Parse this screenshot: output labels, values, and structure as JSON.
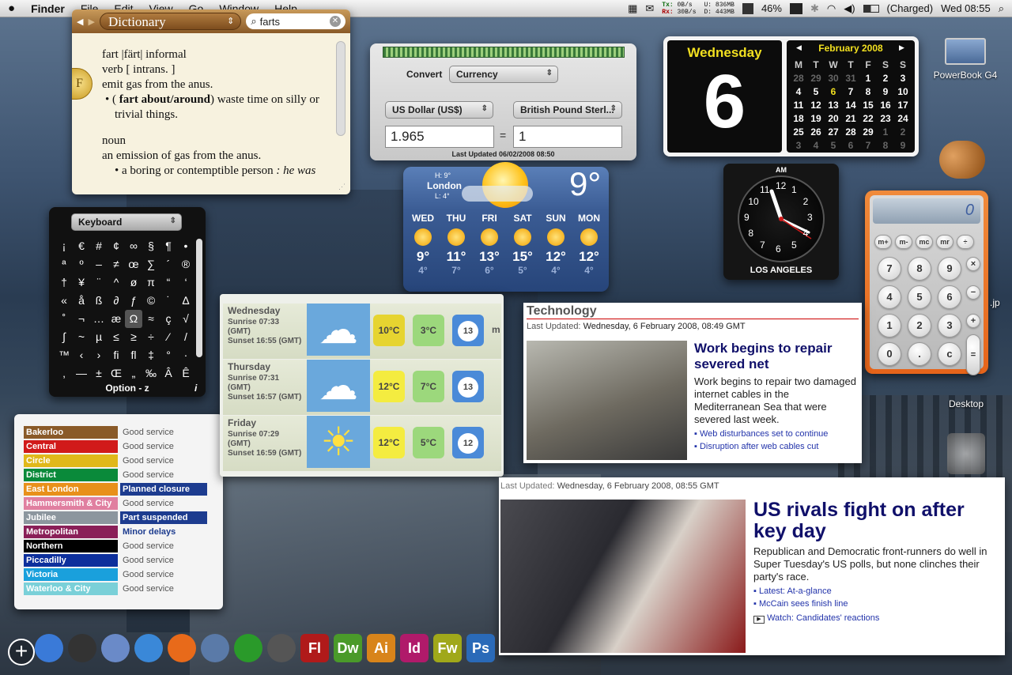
{
  "menubar": {
    "apple": "",
    "app": "Finder",
    "items": [
      "File",
      "Edit",
      "View",
      "Go",
      "Window",
      "Help"
    ],
    "net": {
      "tx_label": "Tx:",
      "rx_label": "Rx:",
      "tx_rate": "0B/s",
      "rx_rate": "30B/s",
      "u_label": "U:",
      "d_label": "D:",
      "u_val": "836MB",
      "d_val": "443MB"
    },
    "battery": "46%",
    "charge_status": "(Charged)",
    "clock": "Wed 08:55"
  },
  "dictionary": {
    "source": "Dictionary",
    "query": "farts",
    "headword": "fart |färt| informal",
    "pos1": "verb [ intrans. ]",
    "def1": "emit gas from the anus.",
    "sub1_bold": "fart about/around",
    "sub1_rest": " waste time on silly or trivial things.",
    "sub1_prefix": "( ",
    "sub1_close": ")",
    "pos2": "noun",
    "def2": "an emission of gas from the anus.",
    "def3": "a boring or contemptible person",
    "def3_example": " : he was",
    "badge": "F"
  },
  "currency": {
    "convert_label": "Convert",
    "mode": "Currency",
    "from": "US Dollar (US$)",
    "to": "British Pound Sterl...",
    "from_value": "1.965",
    "to_value": "1",
    "equals": "=",
    "updated": "Last Updated 06/02/2008 08:50"
  },
  "keyboard_viewer": {
    "mode": "Keyboard",
    "chars": [
      "¡",
      "€",
      "#",
      "¢",
      "∞",
      "§",
      "¶",
      "•",
      "ª",
      "º",
      "–",
      "≠",
      "œ",
      "∑",
      "´",
      "®",
      "†",
      "¥",
      "¨",
      "^",
      "ø",
      "π",
      "“",
      "‘",
      "«",
      "å",
      "ß",
      "∂",
      "ƒ",
      "©",
      "˙",
      "∆",
      "˚",
      "¬",
      "…",
      "æ",
      "Ω",
      "≈",
      "ç",
      "√",
      "∫",
      "~",
      "µ",
      "≤",
      "≥",
      "÷",
      "⁄",
      "/",
      "™",
      "‹",
      "›",
      "fi",
      "fl",
      "‡",
      "°",
      "·",
      "‚",
      "—",
      "±",
      "Œ",
      "„",
      "‰",
      "Â",
      "Ê"
    ],
    "footer": "Option - z",
    "info": "i"
  },
  "weather": {
    "city": "London",
    "high": "H: 9°",
    "low": "L: 4°",
    "current": "9°",
    "days": [
      {
        "d": "WED",
        "hi": "9°",
        "lo": "4°"
      },
      {
        "d": "THU",
        "hi": "11°",
        "lo": "7°"
      },
      {
        "d": "FRI",
        "hi": "13°",
        "lo": "6°"
      },
      {
        "d": "SAT",
        "hi": "15°",
        "lo": "5°"
      },
      {
        "d": "SUN",
        "hi": "12°",
        "lo": "4°"
      },
      {
        "d": "MON",
        "hi": "12°",
        "lo": "4°"
      }
    ]
  },
  "calendar": {
    "weekday": "Wednesday",
    "day": "6",
    "month": "February 2008",
    "headers": [
      "M",
      "T",
      "W",
      "T",
      "F",
      "S",
      "S"
    ],
    "weeks": [
      [
        "28",
        "29",
        "30",
        "31",
        "1",
        "2",
        "3"
      ],
      [
        "4",
        "5",
        "6",
        "7",
        "8",
        "9",
        "10"
      ],
      [
        "11",
        "12",
        "13",
        "14",
        "15",
        "16",
        "17"
      ],
      [
        "18",
        "19",
        "20",
        "21",
        "22",
        "23",
        "24"
      ],
      [
        "25",
        "26",
        "27",
        "28",
        "29",
        "1",
        "2"
      ],
      [
        "3",
        "4",
        "5",
        "6",
        "7",
        "8",
        "9"
      ]
    ]
  },
  "clock": {
    "ampm": "AM",
    "city": "LOS ANGELES",
    "numbers": [
      "12",
      "1",
      "2",
      "3",
      "4",
      "5",
      "6",
      "7",
      "8",
      "9",
      "10",
      "11"
    ]
  },
  "calculator": {
    "display": "0",
    "rows": [
      [
        "m+",
        "m-",
        "mc",
        "mr",
        "÷"
      ],
      [
        "7",
        "8",
        "9",
        "×"
      ],
      [
        "4",
        "5",
        "6",
        "−"
      ],
      [
        "1",
        "2",
        "3",
        "+"
      ],
      [
        "0",
        ".",
        "c",
        "="
      ]
    ]
  },
  "tube": {
    "lines": [
      {
        "name": "Bakerloo",
        "color": "#8a5a28",
        "status": "Good service",
        "kind": "good"
      },
      {
        "name": "Central",
        "color": "#d11a1a",
        "status": "Good service",
        "kind": "good"
      },
      {
        "name": "Circle",
        "color": "#e0b81a",
        "status": "Good service",
        "kind": "good"
      },
      {
        "name": "District",
        "color": "#0a8a3a",
        "status": "Good service",
        "kind": "good"
      },
      {
        "name": "East London",
        "color": "#e8901a",
        "status": "Planned closure",
        "kind": "alert"
      },
      {
        "name": "Hammersmith & City",
        "color": "#e07fa0",
        "status": "Good service",
        "kind": "good"
      },
      {
        "name": "Jubilee",
        "color": "#8c969e",
        "status": "Part suspended",
        "kind": "alert"
      },
      {
        "name": "Metropolitan",
        "color": "#8a1f58",
        "status": "Minor delays",
        "kind": "minor"
      },
      {
        "name": "Northern",
        "color": "#000000",
        "status": "Good service",
        "kind": "good"
      },
      {
        "name": "Piccadilly",
        "color": "#0d2f9c",
        "status": "Good service",
        "kind": "good"
      },
      {
        "name": "Victoria",
        "color": "#1aa0dc",
        "status": "Good service",
        "kind": "good"
      },
      {
        "name": "Waterloo & City",
        "color": "#7ad0d8",
        "status": "Good service",
        "kind": "good"
      }
    ]
  },
  "forecast3": {
    "overflow_unit": "m",
    "days": [
      {
        "day": "Wednesday",
        "sunrise": "Sunrise 07:33 (GMT)",
        "sunset": "Sunset 16:55 (GMT)",
        "max": "10°C",
        "min": "3°C",
        "wind": "13"
      },
      {
        "day": "Thursday",
        "sunrise": "Sunrise 07:31 (GMT)",
        "sunset": "Sunset 16:57 (GMT)",
        "max": "12°C",
        "min": "7°C",
        "wind": "13"
      },
      {
        "day": "Friday",
        "sunrise": "Sunrise 07:29 (GMT)",
        "sunset": "Sunset 16:59 (GMT)",
        "max": "12°C",
        "min": "5°C",
        "wind": "12"
      }
    ]
  },
  "tech_news": {
    "section": "Technology",
    "updated_label": "Last Updated:",
    "updated": "Wednesday, 6 February 2008, 08:49 GMT",
    "headline": "Work begins to repair severed net",
    "summary": "Work begins to repair two damaged internet cables in the Mediterranean Sea that were severed last week.",
    "links": [
      "Web disturbances set to continue",
      "Disruption after web cables cut"
    ]
  },
  "us_news": {
    "updated_label": "Last Updated:",
    "updated": "Wednesday, 6 February 2008, 08:55 GMT",
    "headline": "US rivals fight on after key day",
    "summary": "Republican and Democratic front-runners do well in Super Tuesday's US polls, but none clinches their party's race.",
    "links": [
      "Latest: At-a-glance",
      "McCain sees finish line"
    ],
    "video_link": "Watch: Candidates' reactions"
  },
  "desktop": {
    "icons": [
      "PowerBook G4",
      "Desktop"
    ],
    "partial_label": ".jp"
  },
  "dock": {
    "add": "+",
    "apps": [
      {
        "name": "Finder",
        "label": "",
        "color": "#3a7ad8"
      },
      {
        "name": "Dashboard",
        "label": "",
        "color": "#333"
      },
      {
        "name": "Mail",
        "label": "",
        "color": "#6a8ac8"
      },
      {
        "name": "Safari",
        "label": "",
        "color": "#3a88d8"
      },
      {
        "name": "Firefox",
        "label": "",
        "color": "#e86a1a"
      },
      {
        "name": "iPhoto",
        "label": "",
        "color": "#5a7aa8"
      },
      {
        "name": "Xgrid",
        "label": "",
        "color": "#2a9a2a"
      },
      {
        "name": "Image Capture",
        "label": "",
        "color": "#555"
      },
      {
        "name": "Flash",
        "label": "Fl",
        "color": "#b01a1a"
      },
      {
        "name": "Dreamweaver",
        "label": "Dw",
        "color": "#4a9a2a"
      },
      {
        "name": "Illustrator",
        "label": "Ai",
        "color": "#d8841a"
      },
      {
        "name": "InDesign",
        "label": "Id",
        "color": "#b01a6a"
      },
      {
        "name": "Fireworks",
        "label": "Fw",
        "color": "#a0a81a"
      },
      {
        "name": "Photoshop",
        "label": "Ps",
        "color": "#2a6ab8"
      }
    ]
  }
}
